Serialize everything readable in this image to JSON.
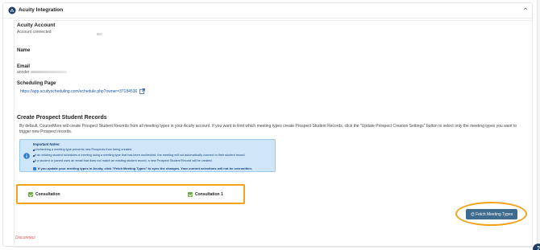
{
  "header": {
    "title": "Acuity Integration",
    "collapse_icon": "chevron-up-icon"
  },
  "account": {
    "label": "Acuity Account",
    "status": "Account connected"
  },
  "name": {
    "label": "Name"
  },
  "email": {
    "label": "Email",
    "value_partial": "annder"
  },
  "scheduling": {
    "label": "Scheduling Page",
    "url": "https://app.acuityscheduling.com/schedule.php?owner=37184536"
  },
  "prospect": {
    "title": "Create Prospect Student Records",
    "description": "By default, CourseMore will create Prospect Student Records from all meeting types in your Acuity account. If you want to limit which meeting types create Prospect Student Records, click the \"Update Prospect Creation Settings\" button to select only the meeting types you want to trigger new Prospect records."
  },
  "notice": {
    "title": "Important Notes:",
    "lines": [
      "Unchecking a meeting type prevents new Prospects from being created.",
      "If an existing student schedules a meeting using a meeting type that has been unchecked, the meeting will not automatically connect to their student record.",
      "If a student or parent uses an email that does not match an existing student record, a new Prospect Student Record will be created."
    ],
    "strong": "If you update your meeting types in Acuity, click \"Fetch Meeting Types\" to sync the changes. Your current selections will not be overwritten."
  },
  "meeting_types": [
    {
      "label": "Consultation",
      "checked": true
    },
    {
      "label": "Consultation 1",
      "checked": true
    }
  ],
  "fetch_button": {
    "label": "Fetch Meeting Types"
  },
  "disconnect": {
    "label": "Disconnect"
  },
  "help": {
    "label": "?"
  }
}
